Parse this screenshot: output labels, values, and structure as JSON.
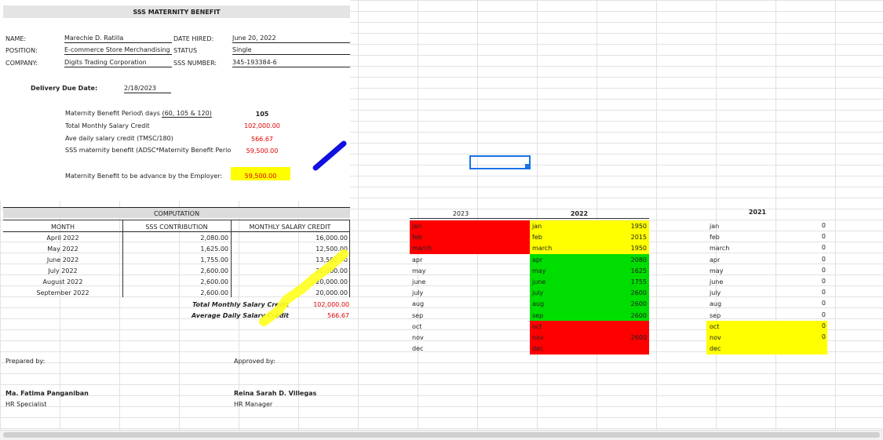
{
  "form": {
    "title": "SSS MATERNITY BENEFIT",
    "name_label": "NAME:",
    "name_value": "Marechie D. Ratilla",
    "position_label": "POSITION:",
    "position_value": "E-commerce Store Merchandising",
    "company_label": "COMPANY:",
    "company_value": "Digits Trading Corporation",
    "date_hired_label": "DATE HIRED:",
    "date_hired_value": "June 20, 2022",
    "status_label": "STATUS",
    "status_value": "Single",
    "sss_number_label": "SSS NUMBER:",
    "sss_number_value": "345-193384-6",
    "delivery_label": "Delivery Due Date:",
    "delivery_value": "2/18/2023",
    "mbp_label": "Maternity Benefit Period\\ days ",
    "mbp_options": "(60, 105 & 120)",
    "mbp_value": "105",
    "tmsc_label": "Total Monthly Salary Credit",
    "tmsc_value": "102,000.00",
    "adsc_label": "Ave daily salary credit (TMSC/180)",
    "adsc_value": "566.67",
    "smb_label": "SSS maternity benefit (ADSC*Maternity Benefit Perio",
    "smb_value": "59,500.00",
    "advance_label": "Maternity Benefit to be advance by the Employer:",
    "advance_value": "59,500.00"
  },
  "computation": {
    "title": "COMPUTATION",
    "col_month": "MONTH",
    "col_contribution": "SSS CONTRIBUTION",
    "col_msc": "MONTHLY SALARY CREDIT",
    "rows": [
      {
        "month": "April 2022",
        "contribution": "2,080.00",
        "msc": "16,000.00"
      },
      {
        "month": "May 2022",
        "contribution": "1,625.00",
        "msc": "12,500.00"
      },
      {
        "month": "June 2022",
        "contribution": "1,755.00",
        "msc": "13,500.00"
      },
      {
        "month": "July 2022",
        "contribution": "2,600.00",
        "msc": "20,000.00"
      },
      {
        "month": "August 2022",
        "contribution": "2,600.00",
        "msc": "20,000.00"
      },
      {
        "month": "September 2022",
        "contribution": "2,600.00",
        "msc": "20,000.00"
      }
    ],
    "total_label": "Total Monthly Salary Credit",
    "total_value": "102,000.00",
    "avg_label": "Average Daily Salary Credit",
    "avg_value": "566.67"
  },
  "signatures": {
    "prepared_label": "Prepared by:",
    "approved_label": "Approved by:",
    "preparer_name": "Ma. Fatima Panganiban",
    "preparer_title": "HR Specialist",
    "approver_name": "Reina Sarah D. Villegas",
    "approver_title": "HR Manager"
  },
  "months_table": {
    "year_2023": "2023",
    "year_2022": "2022",
    "year_2021": "2021",
    "months_2023": [
      "jan",
      "feb",
      "march",
      "apr",
      "may",
      "june",
      "july",
      "aug",
      "sep",
      "oct",
      "nov",
      "dec"
    ],
    "months_2022": [
      "jan",
      "feb",
      "march",
      "apr",
      "may",
      "june",
      "july",
      "aug",
      "sep",
      "oct",
      "nov",
      "dec"
    ],
    "values_2022": [
      "1950",
      "2015",
      "1950",
      "2080",
      "1625",
      "1755",
      "2600",
      "2600",
      "2600",
      "",
      "2600",
      ""
    ],
    "months_2021": [
      "jan",
      "feb",
      "march",
      "apr",
      "may",
      "june",
      "july",
      "aug",
      "sep",
      "oct",
      "nov",
      "dec"
    ],
    "values_2021": [
      "0",
      "0",
      "0",
      "0",
      "0",
      "0",
      "0",
      "0",
      "0",
      "0",
      "0",
      ""
    ]
  },
  "colors": {
    "red": "#ff0000",
    "yellow": "#ffff00",
    "green": "#00dd00",
    "blue": "#1a73e8"
  }
}
